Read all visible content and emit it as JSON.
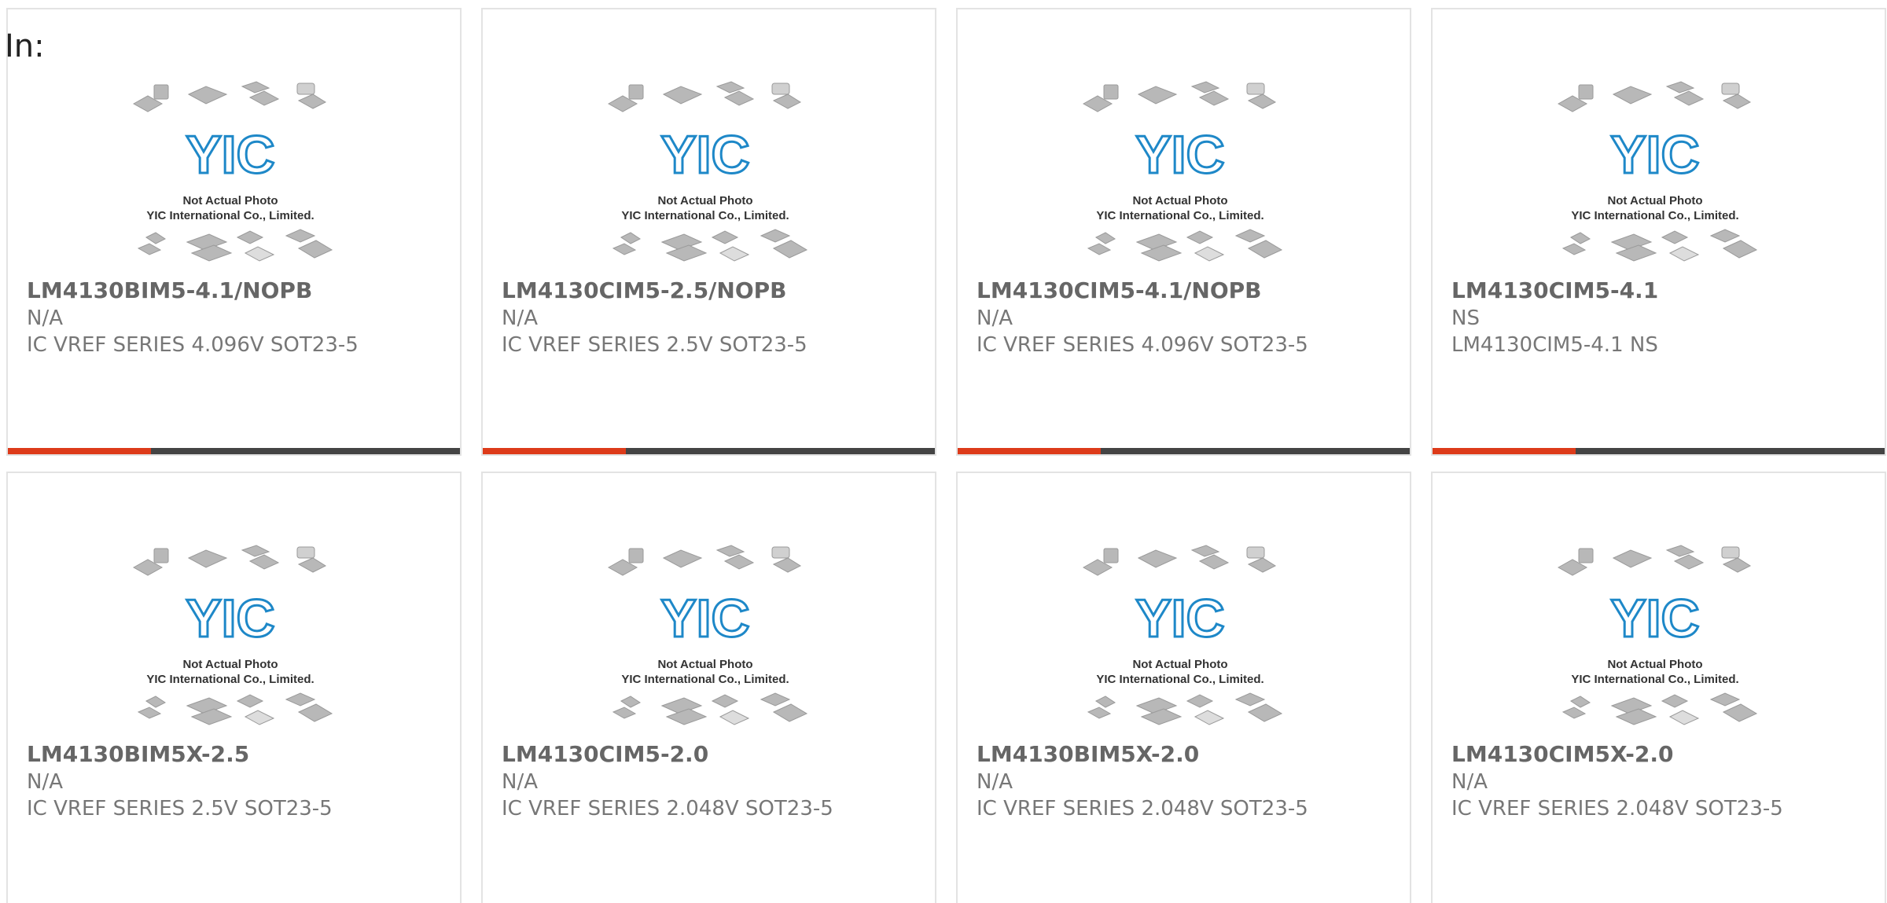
{
  "header": {
    "label": "In:"
  },
  "photo": {
    "logo": "YIC",
    "caption_line1": "Not Actual Photo",
    "caption_line2": "YIC International Co., Limited."
  },
  "colors": {
    "accent": "#dd3b1a",
    "bar": "#444444",
    "logo_blue": "#1e88c8"
  },
  "products": [
    {
      "part": "LM4130BIM5-4.1/NOPB",
      "maker": "N/A",
      "desc": "IC VREF SERIES 4.096V SOT23-5"
    },
    {
      "part": "LM4130CIM5-2.5/NOPB",
      "maker": "N/A",
      "desc": "IC VREF SERIES 2.5V SOT23-5"
    },
    {
      "part": "LM4130CIM5-4.1/NOPB",
      "maker": "N/A",
      "desc": "IC VREF SERIES 4.096V SOT23-5"
    },
    {
      "part": "LM4130CIM5-4.1",
      "maker": "NS",
      "desc": "LM4130CIM5-4.1 NS"
    },
    {
      "part": "LM4130BIM5X-2.5",
      "maker": "N/A",
      "desc": "IC VREF SERIES 2.5V SOT23-5"
    },
    {
      "part": "LM4130CIM5-2.0",
      "maker": "N/A",
      "desc": "IC VREF SERIES 2.048V SOT23-5"
    },
    {
      "part": "LM4130BIM5X-2.0",
      "maker": "N/A",
      "desc": "IC VREF SERIES 2.048V SOT23-5"
    },
    {
      "part": "LM4130CIM5X-2.0",
      "maker": "N/A",
      "desc": "IC VREF SERIES 2.048V SOT23-5"
    }
  ]
}
